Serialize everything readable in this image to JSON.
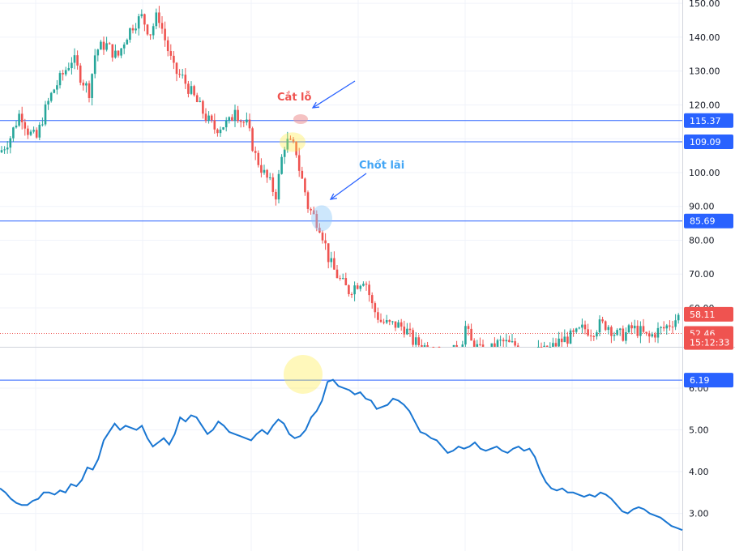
{
  "chart_data": [
    {
      "type": "candlestick",
      "pane": "price",
      "y_ticks": [
        "150.00",
        "140.00",
        "130.00",
        "120.00",
        "110.00",
        "100.00",
        "90.00",
        "80.00",
        "70.00",
        "60.00"
      ],
      "ylim": [
        48.5,
        151
      ],
      "levels": [
        {
          "value": 115.37,
          "label": "115.37",
          "color": "#2962ff"
        },
        {
          "value": 109.09,
          "label": "109.09",
          "color": "#2962ff"
        },
        {
          "value": 85.69,
          "label": "85.69",
          "color": "#2962ff"
        }
      ],
      "price_tags": [
        {
          "value": 58.11,
          "label": "58.11",
          "color": "#ef5350"
        },
        {
          "value": 52.46,
          "label": "52.46",
          "color": "#ef5350"
        },
        {
          "value": 49.8,
          "label": "15:12:33",
          "color": "#ef5350"
        }
      ],
      "current_price_line": 52.46,
      "annotations": [
        {
          "text": "Cắt lỗ",
          "color": "#ef5350"
        },
        {
          "text": "Chốt lãi",
          "color": "#42a5f5"
        }
      ],
      "path": [
        [
          0,
          106
        ],
        [
          12,
          110
        ],
        [
          25,
          118
        ],
        [
          35,
          112
        ],
        [
          45,
          110
        ],
        [
          55,
          118
        ],
        [
          65,
          124
        ],
        [
          80,
          130
        ],
        [
          90,
          134
        ],
        [
          100,
          128
        ],
        [
          110,
          124
        ],
        [
          118,
          136
        ],
        [
          130,
          138
        ],
        [
          145,
          134
        ],
        [
          155,
          140
        ],
        [
          165,
          144
        ],
        [
          175,
          146
        ],
        [
          185,
          141
        ],
        [
          195,
          147
        ],
        [
          205,
          138
        ],
        [
          215,
          130
        ],
        [
          225,
          128
        ],
        [
          235,
          124
        ],
        [
          245,
          120
        ],
        [
          255,
          116
        ],
        [
          265,
          113
        ],
        [
          275,
          114
        ],
        [
          285,
          115
        ],
        [
          290,
          120
        ],
        [
          295,
          116
        ],
        [
          305,
          114
        ],
        [
          315,
          105
        ],
        [
          325,
          100
        ],
        [
          335,
          96
        ],
        [
          340,
          93
        ],
        [
          345,
          100
        ],
        [
          350,
          108
        ],
        [
          355,
          109
        ],
        [
          360,
          108
        ],
        [
          365,
          107
        ],
        [
          370,
          100
        ],
        [
          375,
          96
        ],
        [
          380,
          90
        ],
        [
          385,
          88
        ],
        [
          390,
          86
        ],
        [
          395,
          84
        ],
        [
          400,
          80
        ],
        [
          405,
          75
        ],
        [
          410,
          72
        ],
        [
          420,
          68
        ],
        [
          430,
          65
        ],
        [
          440,
          67
        ],
        [
          450,
          69
        ],
        [
          460,
          60
        ],
        [
          470,
          56
        ],
        [
          480,
          55
        ],
        [
          490,
          55
        ],
        [
          500,
          54
        ],
        [
          510,
          50
        ],
        [
          520,
          49
        ],
        [
          530,
          48
        ],
        [
          540,
          48
        ],
        [
          550,
          45
        ],
        [
          560,
          47
        ],
        [
          570,
          50
        ],
        [
          575,
          55
        ],
        [
          580,
          50
        ],
        [
          590,
          48
        ],
        [
          600,
          45
        ],
        [
          610,
          49
        ],
        [
          620,
          50
        ],
        [
          630,
          49
        ],
        [
          640,
          49
        ],
        [
          650,
          48
        ],
        [
          660,
          47
        ],
        [
          670,
          47
        ],
        [
          680,
          48
        ],
        [
          690,
          50
        ],
        [
          700,
          51
        ],
        [
          710,
          52
        ],
        [
          720,
          54
        ],
        [
          730,
          53
        ],
        [
          740,
          55
        ],
        [
          750,
          55
        ],
        [
          760,
          52
        ],
        [
          770,
          52
        ],
        [
          780,
          54
        ],
        [
          790,
          53
        ],
        [
          800,
          51
        ],
        [
          810,
          53
        ],
        [
          820,
          54
        ],
        [
          830,
          56
        ],
        [
          840,
          58
        ]
      ]
    },
    {
      "type": "line",
      "pane": "indicator",
      "y_ticks": [
        "6.00",
        "5.00",
        "4.00",
        "3.00"
      ],
      "ylim": [
        2.1,
        6.95
      ],
      "levels": [
        {
          "value": 6.19,
          "label": "6.19",
          "color": "#2962ff"
        }
      ],
      "line_color": "#1976d2",
      "values": [
        3.6,
        3.5,
        3.35,
        3.25,
        3.2,
        3.2,
        3.3,
        3.35,
        3.5,
        3.5,
        3.45,
        3.55,
        3.5,
        3.7,
        3.65,
        3.8,
        4.1,
        4.05,
        4.3,
        4.75,
        4.95,
        5.15,
        5.0,
        5.1,
        5.05,
        5.0,
        5.1,
        4.8,
        4.6,
        4.7,
        4.8,
        4.65,
        4.9,
        5.3,
        5.2,
        5.35,
        5.3,
        5.1,
        4.9,
        5.0,
        5.2,
        5.1,
        4.95,
        4.9,
        4.85,
        4.8,
        4.75,
        4.9,
        5.0,
        4.9,
        5.1,
        5.25,
        5.15,
        4.9,
        4.8,
        4.85,
        5.0,
        5.3,
        5.45,
        5.7,
        6.15,
        6.2,
        6.05,
        6.0,
        5.95,
        5.85,
        5.9,
        5.75,
        5.7,
        5.5,
        5.55,
        5.6,
        5.75,
        5.7,
        5.6,
        5.45,
        5.2,
        4.95,
        4.9,
        4.8,
        4.75,
        4.6,
        4.45,
        4.5,
        4.6,
        4.55,
        4.6,
        4.7,
        4.55,
        4.5,
        4.55,
        4.6,
        4.5,
        4.45,
        4.55,
        4.6,
        4.5,
        4.55,
        4.35,
        4.0,
        3.75,
        3.6,
        3.55,
        3.6,
        3.5,
        3.5,
        3.45,
        3.4,
        3.45,
        3.4,
        3.5,
        3.45,
        3.35,
        3.2,
        3.05,
        3.0,
        3.1,
        3.15,
        3.1,
        3.0,
        2.95,
        2.9,
        2.8,
        2.7,
        2.65,
        2.6
      ]
    }
  ]
}
